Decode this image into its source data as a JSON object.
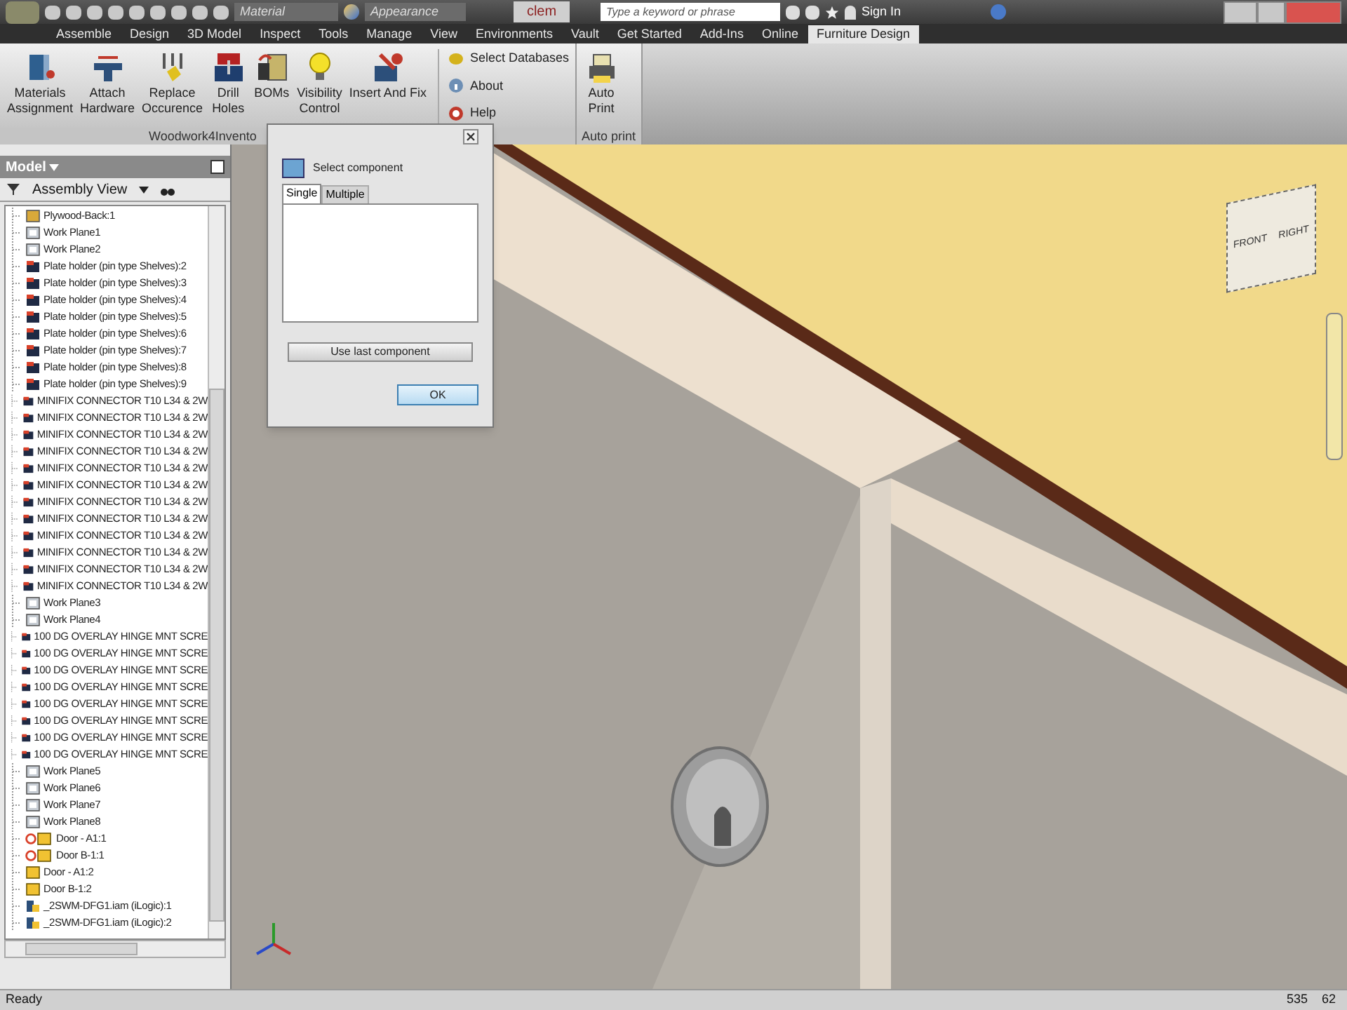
{
  "quick_access": {
    "material": "Material",
    "appearance": "Appearance",
    "project": "clem",
    "search_placeholder": "Type a keyword or phrase",
    "sign_in": "Sign In"
  },
  "tabs": [
    {
      "label": "Assemble",
      "selected": false
    },
    {
      "label": "Design",
      "selected": false
    },
    {
      "label": "3D Model",
      "selected": false
    },
    {
      "label": "Inspect",
      "selected": false
    },
    {
      "label": "Tools",
      "selected": false
    },
    {
      "label": "Manage",
      "selected": false
    },
    {
      "label": "View",
      "selected": false
    },
    {
      "label": "Environments",
      "selected": false
    },
    {
      "label": "Vault",
      "selected": false
    },
    {
      "label": "Get Started",
      "selected": false
    },
    {
      "label": "Add-Ins",
      "selected": false
    },
    {
      "label": "Online",
      "selected": false
    },
    {
      "label": "Furniture Design",
      "selected": true
    }
  ],
  "ribbon": {
    "panels": [
      {
        "label": "Woodwork4Invento",
        "buttons": [
          {
            "kind": "materials",
            "lines": [
              "Materials",
              "Assignment"
            ]
          },
          {
            "kind": "hardware",
            "lines": [
              "Attach",
              "Hardware"
            ]
          },
          {
            "kind": "replace",
            "lines": [
              "Replace",
              "Occurence"
            ]
          },
          {
            "kind": "drill",
            "lines": [
              "Drill",
              "Holes"
            ]
          },
          {
            "kind": "boms",
            "lines": [
              "BOMs"
            ]
          },
          {
            "kind": "bulb",
            "lines": [
              "Visibility",
              "Control"
            ]
          },
          {
            "kind": "insert",
            "lines": [
              "Insert And Fix"
            ]
          }
        ],
        "small_buttons": [
          {
            "kind": "database",
            "label": "Select Databases"
          },
          {
            "kind": "info",
            "label": "About"
          },
          {
            "kind": "help",
            "label": "Help"
          }
        ]
      },
      {
        "label": "Auto print",
        "buttons": [
          {
            "kind": "print",
            "lines": [
              "Auto",
              "Print"
            ]
          }
        ]
      }
    ]
  },
  "browser": {
    "title": "Model",
    "view": "Assembly View",
    "items": [
      {
        "kind": "plywood",
        "label": "Plywood-Back:1"
      },
      {
        "kind": "workplane",
        "label": "Work Plane1"
      },
      {
        "kind": "workplane",
        "label": "Work Plane2"
      },
      {
        "kind": "part",
        "label": "Plate holder (pin type Shelves):2"
      },
      {
        "kind": "part",
        "label": "Plate holder (pin type Shelves):3"
      },
      {
        "kind": "part",
        "label": "Plate holder (pin type Shelves):4"
      },
      {
        "kind": "part",
        "label": "Plate holder (pin type Shelves):5"
      },
      {
        "kind": "part",
        "label": "Plate holder (pin type Shelves):6"
      },
      {
        "kind": "part",
        "label": "Plate holder (pin type Shelves):7"
      },
      {
        "kind": "part",
        "label": "Plate holder (pin type Shelves):8"
      },
      {
        "kind": "part",
        "label": "Plate holder (pin type Shelves):9"
      },
      {
        "kind": "part",
        "label": "MINIFIX CONNECTOR T10 L34 & 2W"
      },
      {
        "kind": "part",
        "label": "MINIFIX CONNECTOR T10 L34 & 2W"
      },
      {
        "kind": "part",
        "label": "MINIFIX CONNECTOR T10 L34 & 2W"
      },
      {
        "kind": "part",
        "label": "MINIFIX CONNECTOR T10 L34 & 2W"
      },
      {
        "kind": "part",
        "label": "MINIFIX CONNECTOR T10 L34 & 2W"
      },
      {
        "kind": "part",
        "label": "MINIFIX CONNECTOR T10 L34 & 2W"
      },
      {
        "kind": "part",
        "label": "MINIFIX CONNECTOR T10 L34 & 2W"
      },
      {
        "kind": "part",
        "label": "MINIFIX CONNECTOR T10 L34 & 2W"
      },
      {
        "kind": "part",
        "label": "MINIFIX CONNECTOR T10 L34 & 2W"
      },
      {
        "kind": "part",
        "label": "MINIFIX CONNECTOR T10 L34 & 2W"
      },
      {
        "kind": "part",
        "label": "MINIFIX CONNECTOR T10 L34 & 2W"
      },
      {
        "kind": "part",
        "label": "MINIFIX CONNECTOR T10 L34 & 2W"
      },
      {
        "kind": "workplane",
        "label": "Work Plane3"
      },
      {
        "kind": "workplane",
        "label": "Work Plane4"
      },
      {
        "kind": "part",
        "label": "100 DG OVERLAY HINGE MNT SCRE"
      },
      {
        "kind": "part",
        "label": "100 DG OVERLAY HINGE MNT SCRE"
      },
      {
        "kind": "part",
        "label": "100 DG OVERLAY HINGE MNT SCRE"
      },
      {
        "kind": "part",
        "label": "100 DG OVERLAY HINGE MNT SCRE"
      },
      {
        "kind": "part",
        "label": "100 DG OVERLAY HINGE MNT SCRE"
      },
      {
        "kind": "part",
        "label": "100 DG OVERLAY HINGE MNT SCRE"
      },
      {
        "kind": "part",
        "label": "100 DG OVERLAY HINGE MNT SCRE"
      },
      {
        "kind": "part",
        "label": "100 DG OVERLAY HINGE MNT SCRE"
      },
      {
        "kind": "workplane",
        "label": "Work Plane5"
      },
      {
        "kind": "workplane",
        "label": "Work Plane6"
      },
      {
        "kind": "workplane",
        "label": "Work Plane7"
      },
      {
        "kind": "workplane",
        "label": "Work Plane8"
      },
      {
        "kind": "door-linked",
        "label": "Door - A1:1"
      },
      {
        "kind": "door-linked",
        "label": "Door B-1:1"
      },
      {
        "kind": "door",
        "label": "Door - A1:2"
      },
      {
        "kind": "door",
        "label": "Door B-1:2"
      },
      {
        "kind": "ilogic",
        "label": "_2SWM-DFG1.iam (iLogic):1"
      },
      {
        "kind": "ilogic",
        "label": "_2SWM-DFG1.iam (iLogic):2"
      }
    ]
  },
  "dialog": {
    "title": "Select component",
    "tabs": [
      {
        "label": "Single",
        "selected": true
      },
      {
        "label": "Multiple",
        "selected": false
      }
    ],
    "use_last": "Use last component",
    "ok": "OK"
  },
  "view_cube": {
    "faces": [
      "FRONT",
      "RIGHT"
    ]
  },
  "status_bar": {
    "text": "Ready",
    "count_1": "535",
    "count_2": "62"
  }
}
